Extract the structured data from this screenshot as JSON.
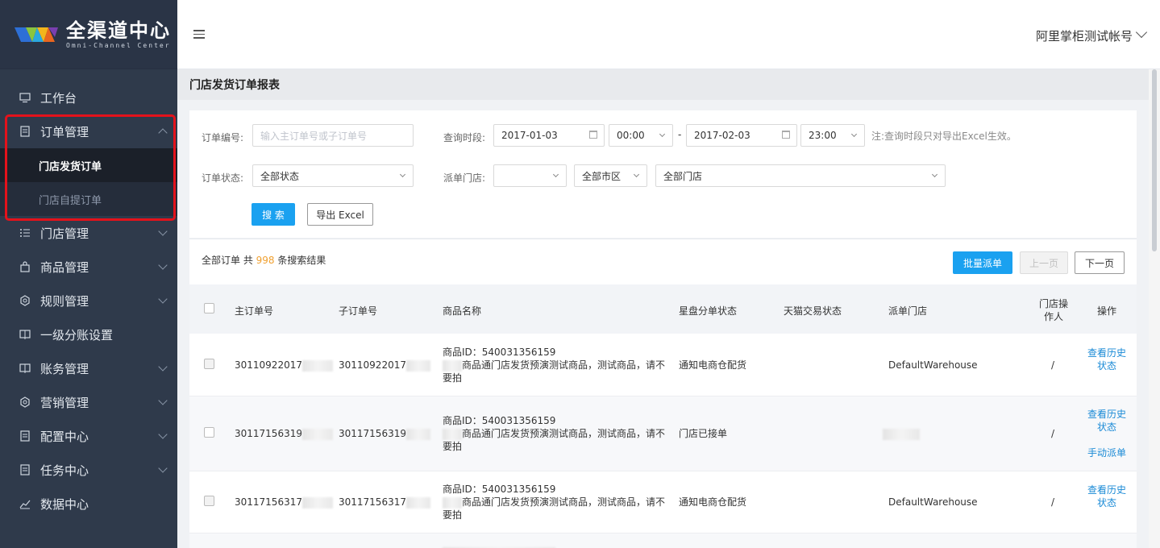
{
  "app": {
    "logo_title": "全渠道中心",
    "logo_sub": "Omni-Channel Center"
  },
  "header": {
    "account_name": "阿里掌柜测试帐号"
  },
  "sidebar": {
    "items": [
      {
        "label": "工作台",
        "icon": "monitor-icon"
      },
      {
        "label": "订单管理",
        "icon": "document-icon",
        "expanded": true
      },
      {
        "label": "门店管理",
        "icon": "list-icon"
      },
      {
        "label": "商品管理",
        "icon": "bag-icon"
      },
      {
        "label": "规则管理",
        "icon": "settings-icon"
      },
      {
        "label": "一级分账设置",
        "icon": "ledger-icon"
      },
      {
        "label": "账务管理",
        "icon": "ledger-icon"
      },
      {
        "label": "营销管理",
        "icon": "settings-icon"
      },
      {
        "label": "配置中心",
        "icon": "document-icon"
      },
      {
        "label": "任务中心",
        "icon": "document-icon"
      },
      {
        "label": "数据中心",
        "icon": "chart-icon"
      }
    ],
    "submenu": [
      {
        "label": "门店发货订单",
        "active": true
      },
      {
        "label": "门店自提订单",
        "active": false
      }
    ]
  },
  "page": {
    "title": "门店发货订单报表"
  },
  "filters": {
    "order_no_label": "订单编号:",
    "order_no_placeholder": "输入主订单号或子订单号",
    "time_label": "查询时段:",
    "start_date": "2017-01-03",
    "start_time": "00:00",
    "dash": "-",
    "end_date": "2017-02-03",
    "end_time": "23:00",
    "time_note": "注:查询时段只对导出Excel生效。",
    "status_label": "订单状态:",
    "status_value": "全部状态",
    "store_label": "派单门店:",
    "province_value": "",
    "city_value": "全部市区",
    "store_value": "全部门店",
    "search_button": "搜 索",
    "export_button": "导出 Excel"
  },
  "results": {
    "prefix": "全部订单 共 ",
    "count": "998",
    "suffix": " 条搜索结果",
    "batch_button": "批量派单",
    "prev_button": "上一页",
    "next_button": "下一页"
  },
  "table": {
    "columns": [
      "主订单号",
      "子订单号",
      "商品名称",
      "星盘分单状态",
      "天猫交易状态",
      "派单门店",
      "门店操作人",
      "操作"
    ],
    "rows": [
      {
        "main_order": "30110922017",
        "sub_order": "30110922017",
        "product_id": "商品ID：540031356159",
        "product_name_1": "商品通门店发货预演测试商品，测试商品，请不",
        "product_name_2": "要拍",
        "split_status": "通知电商仓配货",
        "tmall_status": "",
        "store": "DefaultWarehouse",
        "operator": "/",
        "action_1": "查看历史状态",
        "action_2": ""
      },
      {
        "main_order": "30117156319",
        "sub_order": "30117156319",
        "product_id": "商品ID：540031356159",
        "product_name_1": "商品通门店发货预演测试商品，测试商品，请不",
        "product_name_2": "要拍",
        "split_status": "门店已接单",
        "tmall_status": "",
        "store": "",
        "operator": "/",
        "action_1": "查看历史状态",
        "action_2": "手动派单"
      },
      {
        "main_order": "30117156317",
        "sub_order": "30117156317",
        "product_id": "商品ID：540031356159",
        "product_name_1": "商品通门店发货预演测试商品，测试商品，请不",
        "product_name_2": "要拍",
        "split_status": "通知电商仓配货",
        "tmall_status": "",
        "store": "DefaultWarehouse",
        "operator": "/",
        "action_1": "查看历史状态",
        "action_2": ""
      }
    ]
  },
  "colors": {
    "sidebar_bg": "#2f3a4b",
    "primary": "#1aa1f0",
    "highlight_border": "#e4121b",
    "count_color": "#f0a030",
    "link_color": "#1a8ad6"
  }
}
